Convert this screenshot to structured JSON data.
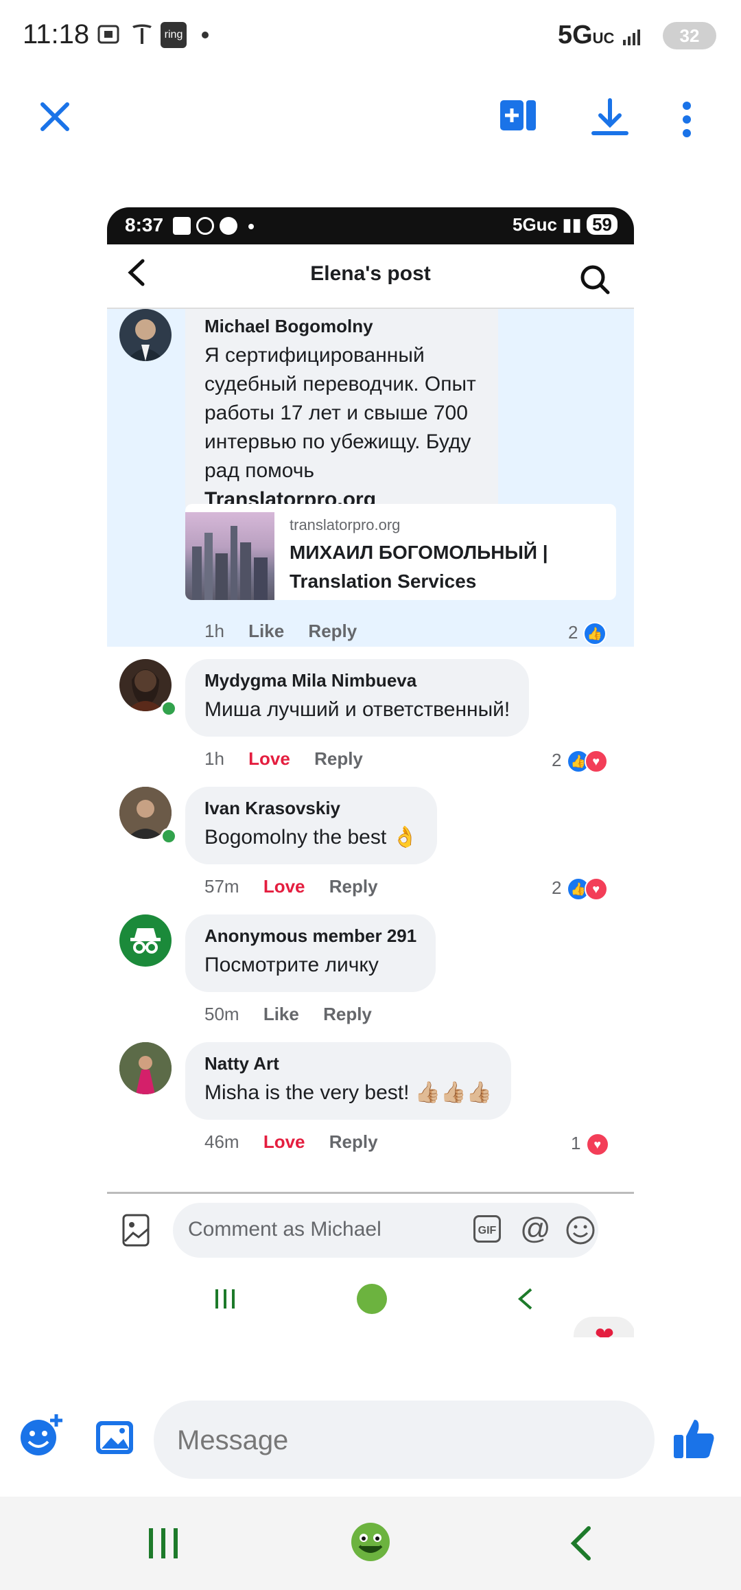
{
  "status_bar": {
    "time": "11:18",
    "network": "5G",
    "network_sub": "UC",
    "battery": "32"
  },
  "inner_status": {
    "time": "8:37",
    "network": "5Guc",
    "battery": "59"
  },
  "post_header": {
    "title": "Elena's post"
  },
  "comments": [
    {
      "name": "Michael Bogomolny",
      "text": "Я сертифицированный судебный переводчик.  Опыт работы 17 лет и свыше 700 интервью по убежищу. Буду рад помочь",
      "link": "Translatorpro.org",
      "preview_site": "translatorpro.org",
      "preview_title": "МИХАИЛ БОГОМОЛЬНЫЙ | Translation Services",
      "time": "1h",
      "action": "Like",
      "reply": "Reply",
      "react_count": "2"
    },
    {
      "name": "Mydygma Mila Nimbueva",
      "text": "Миша лучший и ответственный!",
      "time": "1h",
      "action": "Love",
      "reply": "Reply",
      "react_count": "2"
    },
    {
      "name": "Ivan Krasovskiy",
      "text": "Bogomolny the best 👌",
      "time": "57m",
      "action": "Love",
      "reply": "Reply",
      "react_count": "2"
    },
    {
      "name": "Anonymous member 291",
      "text": "Посмотрите личку",
      "time": "50m",
      "action": "Like",
      "reply": "Reply",
      "react_count": ""
    },
    {
      "name": "Natty Art",
      "text": "Misha is the very best! 👍🏼👍🏼👍🏼",
      "time": "46m",
      "action": "Love",
      "reply": "Reply",
      "react_count": "1"
    }
  ],
  "composer": {
    "placeholder": "Comment as Michael",
    "gif": "GIF"
  },
  "message_bar": {
    "placeholder": "Message"
  },
  "colors": {
    "accent": "#1a73e8",
    "love": "#e41e3f",
    "highlight": "#e7f3ff"
  }
}
